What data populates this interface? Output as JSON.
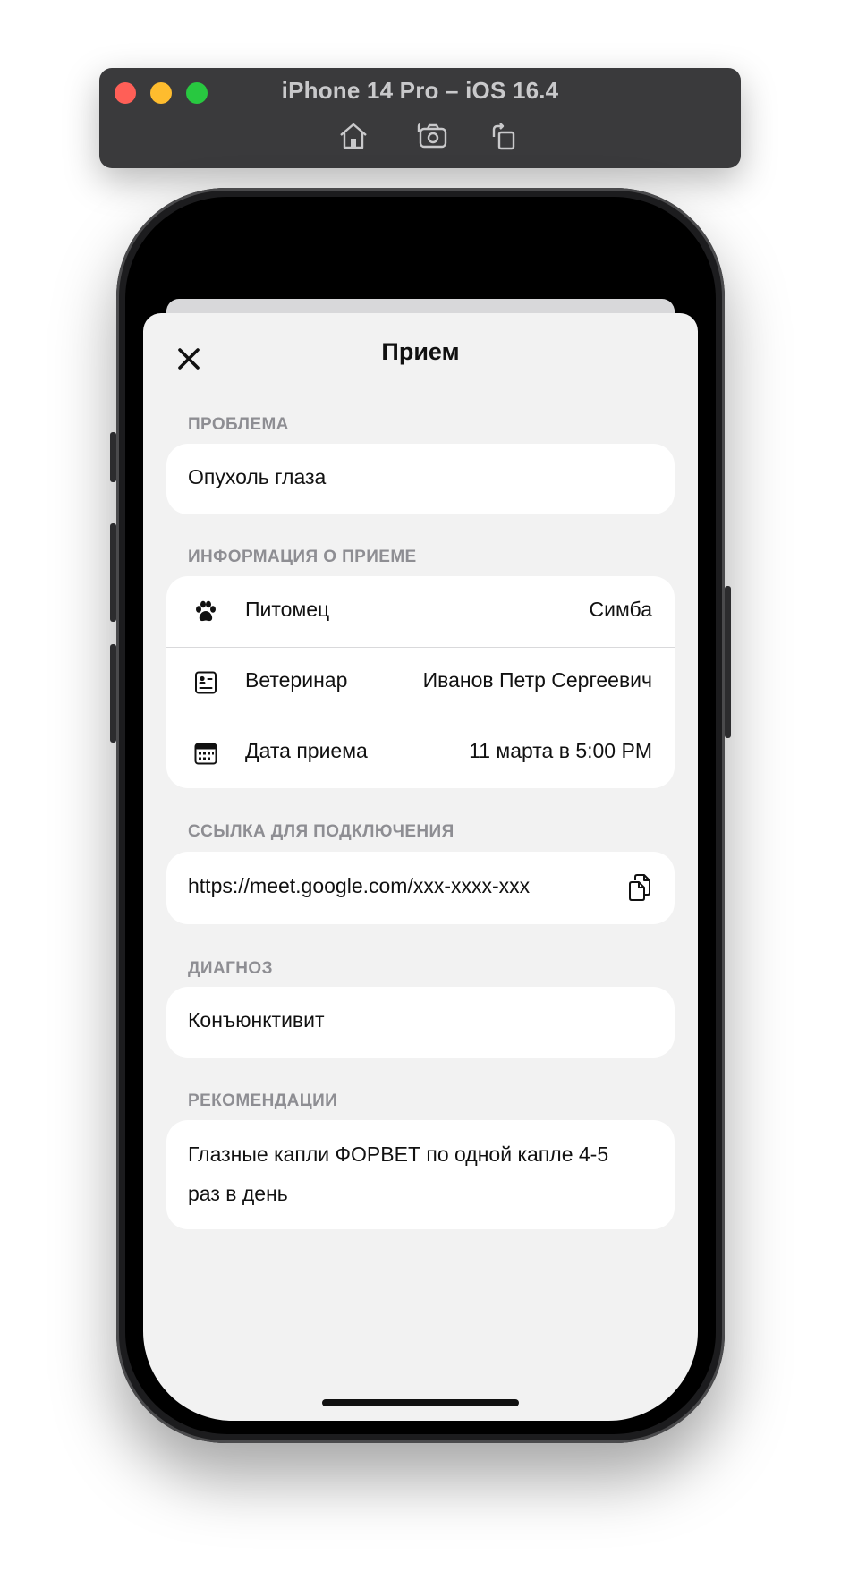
{
  "simulator": {
    "title": "iPhone 14 Pro – iOS 16.4",
    "tools": [
      "home-icon",
      "screenshot-icon",
      "rotate-icon"
    ]
  },
  "sheet": {
    "title": "Прием",
    "close_icon": "close-icon"
  },
  "problem": {
    "label": "ПРОБЛЕМА",
    "value": "Опухоль глаза"
  },
  "info": {
    "label": "ИНФОРМАЦИЯ О ПРИЕМЕ",
    "rows": [
      {
        "icon": "paw-icon",
        "label": "Питомец",
        "value": "Симба"
      },
      {
        "icon": "vet-card-icon",
        "label": "Ветеринар",
        "value": "Иванов Петр Сергеевич"
      },
      {
        "icon": "calendar-icon",
        "label": "Дата приема",
        "value": "11 марта в 5:00 PM"
      }
    ]
  },
  "link": {
    "label": "ССЫЛКА ДЛЯ ПОДКЛЮЧЕНИЯ",
    "value": "https://meet.google.com/xxx-xxxx-xxx",
    "icon": "copy-icon"
  },
  "diagnosis": {
    "label": "ДИАГНОЗ",
    "value": "Конъюнктивит"
  },
  "recommendations": {
    "label": "РЕКОМЕНДАЦИИ",
    "line1": "Глазные капли ФОРВЕТ по одной капле 4-5",
    "line2": "раз в день"
  },
  "colors": {
    "sheet_bg": "#f2f2f2",
    "card_bg": "#ffffff",
    "section_label": "#8e8e93",
    "text": "#111111"
  }
}
